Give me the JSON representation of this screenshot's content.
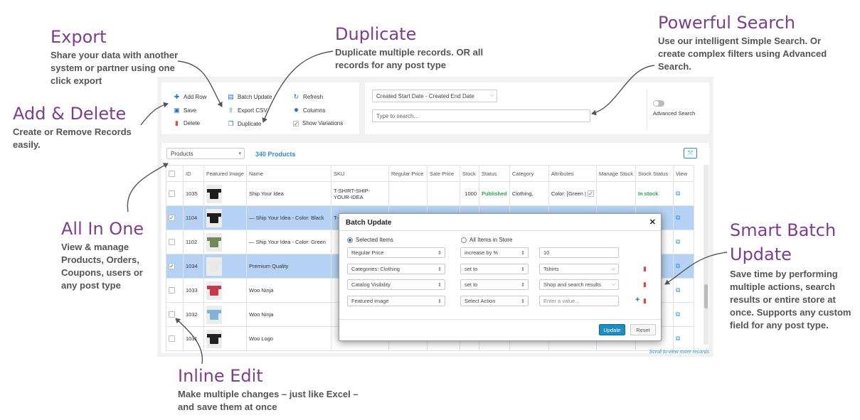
{
  "callouts": {
    "export": {
      "title": "Export",
      "text": "Share your data with another system or partner using one click export"
    },
    "duplicate": {
      "title": "Duplicate",
      "text": "Duplicate multiple records. OR all records for any post type"
    },
    "search": {
      "title": "Powerful Search",
      "text": "Use our intelligent Simple Search. Or create complex filters using Advanced Search."
    },
    "add_delete": {
      "title": "Add & Delete",
      "text": "Create or Remove Records easily."
    },
    "all_in_one": {
      "title": "All In One",
      "text": "View & manage Products, Orders, Coupons, users or any post type"
    },
    "smart_batch": {
      "title_line1": "Smart Batch",
      "title_line2": "Update",
      "text": "Save time by performing multiple actions, search results or entire store at once. Supports any custom field for any post type."
    },
    "inline_edit": {
      "title": "Inline Edit",
      "text": "Make multiple changes – just like Excel – and save them at once"
    }
  },
  "toolbar": {
    "add_row": "Add Row",
    "save": "Save",
    "delete": "Delete",
    "batch_update": "Batch Update",
    "export_csv": "Export CSV",
    "duplicate": "Duplicate",
    "refresh": "Refresh",
    "columns": "Columns",
    "show_variations": "Show Variations"
  },
  "search": {
    "date_filter": "Created Start Date  -  Created End Date",
    "placeholder": "Type to search...",
    "advanced_label": "Advanced Search"
  },
  "grid": {
    "post_type": "Products",
    "count": "340 Products",
    "columns": [
      "ID",
      "Featured Image",
      "Name",
      "SKU",
      "Regular Price",
      "Sale Price",
      "Stock",
      "Status",
      "Category",
      "Attributes",
      "Manage Stock",
      "Stock Status",
      "View"
    ],
    "rows": [
      {
        "id": "1035",
        "name": "Ship Your Idea",
        "sku_line1": "T-SHIRT-SHIP-",
        "sku_line2": "YOUR-IDEA",
        "stock": "1000",
        "status": "Published",
        "category": "Clothing,",
        "attributes": "Color: [Green |",
        "stock_status": "In stock",
        "checked": false,
        "highlight": false,
        "thumb_color": "#1d1d1d"
      },
      {
        "id": "1104",
        "name": "— Ship Your Idea - Color: Black",
        "sku_line1": "T-SHIRT-SHIP-",
        "sku_line2": "",
        "stock": "",
        "status": "",
        "category": "",
        "attributes": "",
        "stock_status": "",
        "checked": true,
        "highlight": true,
        "thumb_color": "#1d1d1d"
      },
      {
        "id": "1102",
        "name": "— Ship Your Idea - Color: Green",
        "sku_line1": "",
        "sku_line2": "",
        "stock": "",
        "status": "",
        "category": "",
        "attributes": "",
        "stock_status": "",
        "checked": false,
        "highlight": false,
        "thumb_color": "#6d8a57"
      },
      {
        "id": "1034",
        "name": "Premium Quality",
        "sku_line1": "",
        "sku_line2": "",
        "stock": "",
        "status": "",
        "category": "",
        "attributes": "",
        "stock_status": "",
        "checked": true,
        "highlight": true,
        "thumb_color": "#e8e8e8"
      },
      {
        "id": "1033",
        "name": "Woo Ninja",
        "sku_line1": "",
        "sku_line2": "",
        "stock": "",
        "status": "",
        "category": "",
        "attributes": "",
        "stock_status": "",
        "checked": false,
        "highlight": false,
        "thumb_color": "#c7384b"
      },
      {
        "id": "1032",
        "name": "Woo Ninja",
        "sku_line1": "",
        "sku_line2": "",
        "stock": "",
        "status": "",
        "category": "",
        "attributes": "",
        "stock_status": "",
        "checked": false,
        "highlight": false,
        "thumb_color": "#7fb3d8"
      },
      {
        "id": "1031",
        "name": "Woo Logo",
        "sku_line1": "",
        "sku_line2": "",
        "stock": "",
        "status": "",
        "category": "",
        "attributes": "",
        "stock_status": "",
        "checked": false,
        "highlight": false,
        "thumb_color": "#222222"
      }
    ],
    "scroll_hint": "Scroll to view more records"
  },
  "batch_modal": {
    "title": "Batch Update",
    "scope_selected": "Selected Items",
    "scope_all": "All Items in Store",
    "rows": [
      {
        "field": "Regular Price",
        "action": "increase by %",
        "value": "10",
        "value_is_select": false,
        "placeholder": false
      },
      {
        "field": "Categories: Clothing",
        "action": "set to",
        "value": "Tshirts",
        "value_is_select": true,
        "placeholder": false
      },
      {
        "field": "Catalog Visibility",
        "action": "set to",
        "value": "Shop and search results",
        "value_is_select": true,
        "placeholder": false
      },
      {
        "field": "Featured image",
        "action": "Select Action",
        "value": "Enter a value...",
        "value_is_select": false,
        "placeholder": true
      }
    ],
    "update_label": "Update",
    "reset_label": "Reset"
  },
  "colors": {
    "accent_purple": "#7b3f8c",
    "brand_blue": "#2b8fd1",
    "row_highlight": "#b5d2f4",
    "published_green": "#2aa44f",
    "delete_red": "#d54e4e"
  }
}
